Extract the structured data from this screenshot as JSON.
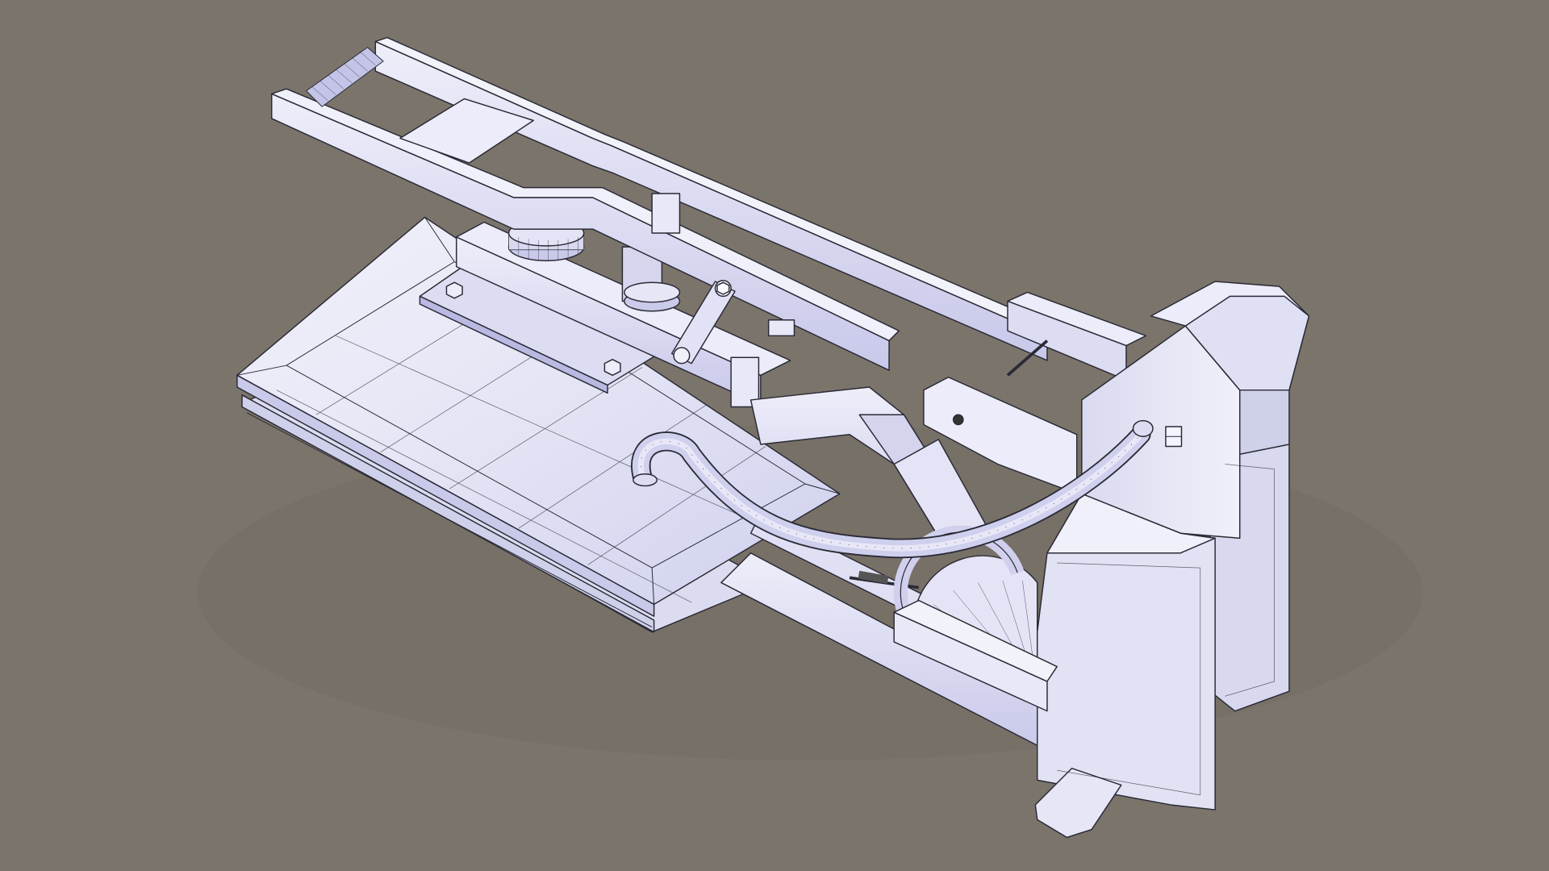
{
  "viewport": {
    "background": "#7b746b",
    "model_fill": "#e6e6f6",
    "model_shade": "#b8b8e0",
    "wire_color": "#2a2a36"
  }
}
